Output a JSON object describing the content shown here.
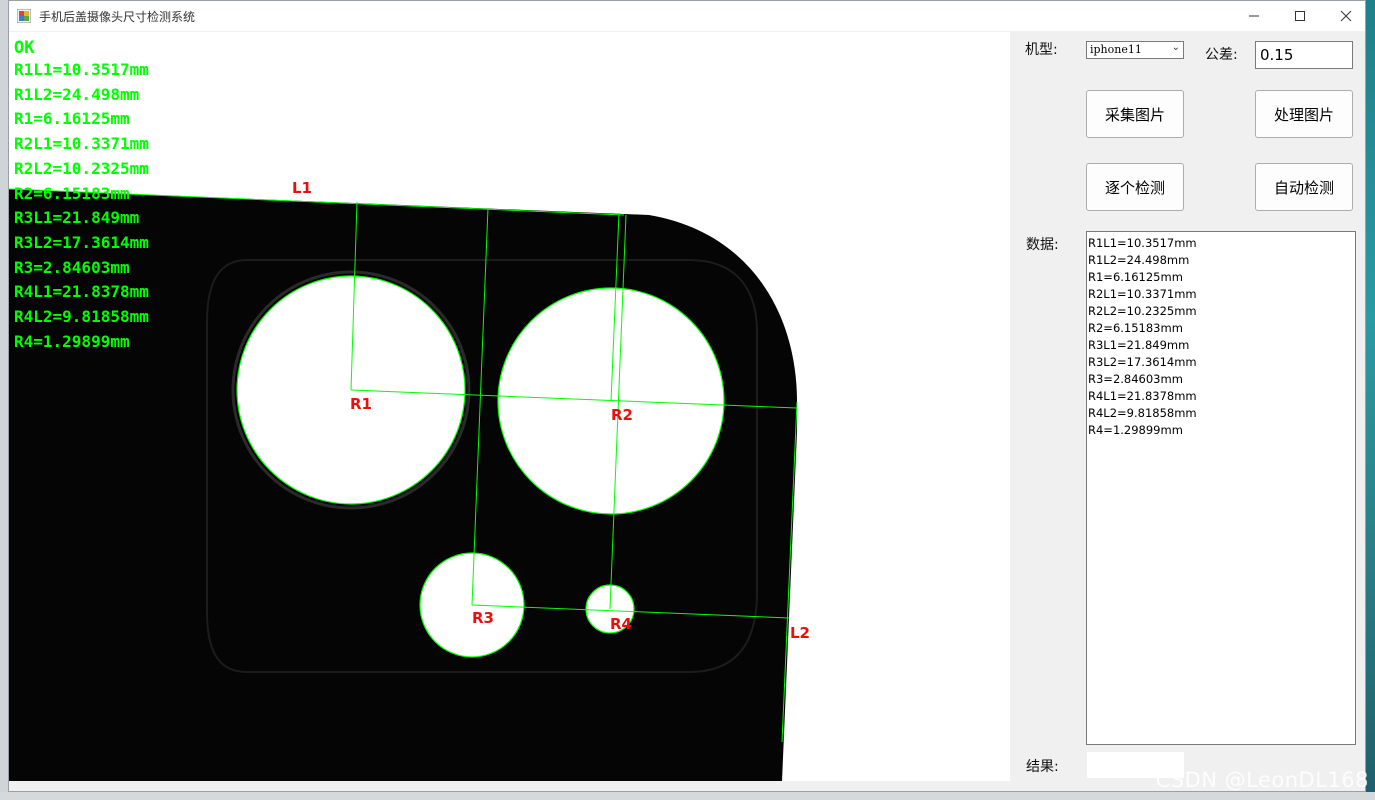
{
  "window": {
    "title": "手机后盖摄像头尺寸检测系统"
  },
  "status": "OK",
  "image_labels": {
    "l1": "L1",
    "l2": "L2",
    "r1": "R1",
    "r2": "R2",
    "r3": "R3",
    "r4": "R4"
  },
  "measurements": [
    "R1L1=10.3517mm",
    "R1L2=24.498mm",
    "R1=6.16125mm",
    "R2L1=10.3371mm",
    "R2L2=10.2325mm",
    "R2=6.15183mm",
    "R3L1=21.849mm",
    "R3L2=17.3614mm",
    "R3=2.84603mm",
    "R4L1=21.8378mm",
    "R4L2=9.81858mm",
    "R4=1.29899mm"
  ],
  "panel": {
    "model_label": "机型:",
    "model_value": "iphone11",
    "tolerance_label": "公差:",
    "tolerance_value": "0.15",
    "capture_button": "采集图片",
    "process_button": "处理图片",
    "step_button": "逐个检测",
    "auto_button": "自动检测",
    "data_label": "数据:",
    "result_label": "结果:",
    "result_value": ""
  },
  "watermark": "CSDN @LeonDL168",
  "colors": {
    "overlay_green": "#00ff00",
    "label_red": "#e8100c",
    "part_black": "#050505"
  }
}
